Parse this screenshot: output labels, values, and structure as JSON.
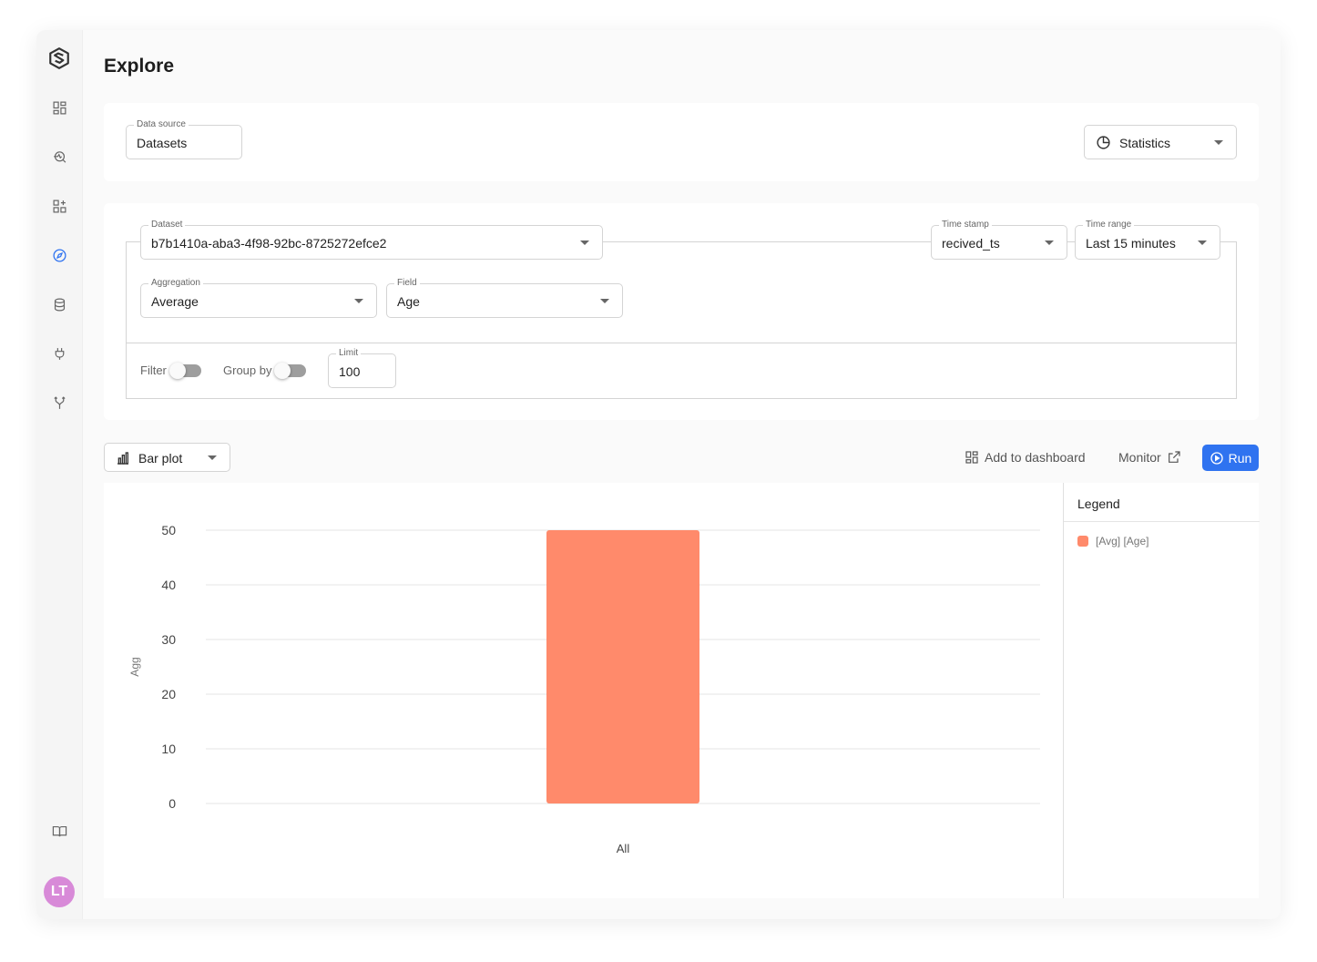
{
  "page": {
    "title": "Explore"
  },
  "sidebar": {
    "items": [
      {
        "name": "dashboard-icon"
      },
      {
        "name": "search-data-icon"
      },
      {
        "name": "widgets-icon"
      },
      {
        "name": "compass-icon",
        "active": true
      },
      {
        "name": "database-icon"
      },
      {
        "name": "plug-icon"
      },
      {
        "name": "fork-icon"
      },
      {
        "name": "book-icon"
      }
    ],
    "avatar_initials": "LT"
  },
  "source": {
    "data_source_label": "Data source",
    "data_source_value": "Datasets",
    "mode_value": "Statistics"
  },
  "query": {
    "dataset_label": "Dataset",
    "dataset_value": "b7b1410a-aba3-4f98-92bc-8725272efce2",
    "timestamp_label": "Time stamp",
    "timestamp_value": "recived_ts",
    "time_range_label": "Time range",
    "time_range_value": "Last 15 minutes",
    "aggregation_label": "Aggregation",
    "aggregation_value": "Average",
    "field_label": "Field",
    "field_value": "Age",
    "filter_label": "Filter",
    "filter_on": false,
    "group_by_label": "Group by",
    "group_by_on": false,
    "limit_label": "Limit",
    "limit_value": "100"
  },
  "toolbar": {
    "plot_type": "Bar plot",
    "add_to_dashboard": "Add to dashboard",
    "monitor": "Monitor",
    "run": "Run"
  },
  "legend": {
    "title": "Legend",
    "items": [
      {
        "label": "[Avg] [Age]",
        "color": "#ff8a6b"
      }
    ]
  },
  "colors": {
    "accent": "#2f73f0",
    "bar": "#ff8a6b",
    "avatar": "#d88ad8"
  },
  "chart_data": {
    "type": "bar",
    "categories": [
      "All"
    ],
    "series": [
      {
        "name": "[Avg] [Age]",
        "values": [
          50
        ]
      }
    ],
    "ylabel": "Agg",
    "ylim": [
      0,
      50
    ],
    "yticks": [
      0,
      10,
      20,
      30,
      40,
      50
    ],
    "grid": true,
    "legend_position": "right"
  }
}
